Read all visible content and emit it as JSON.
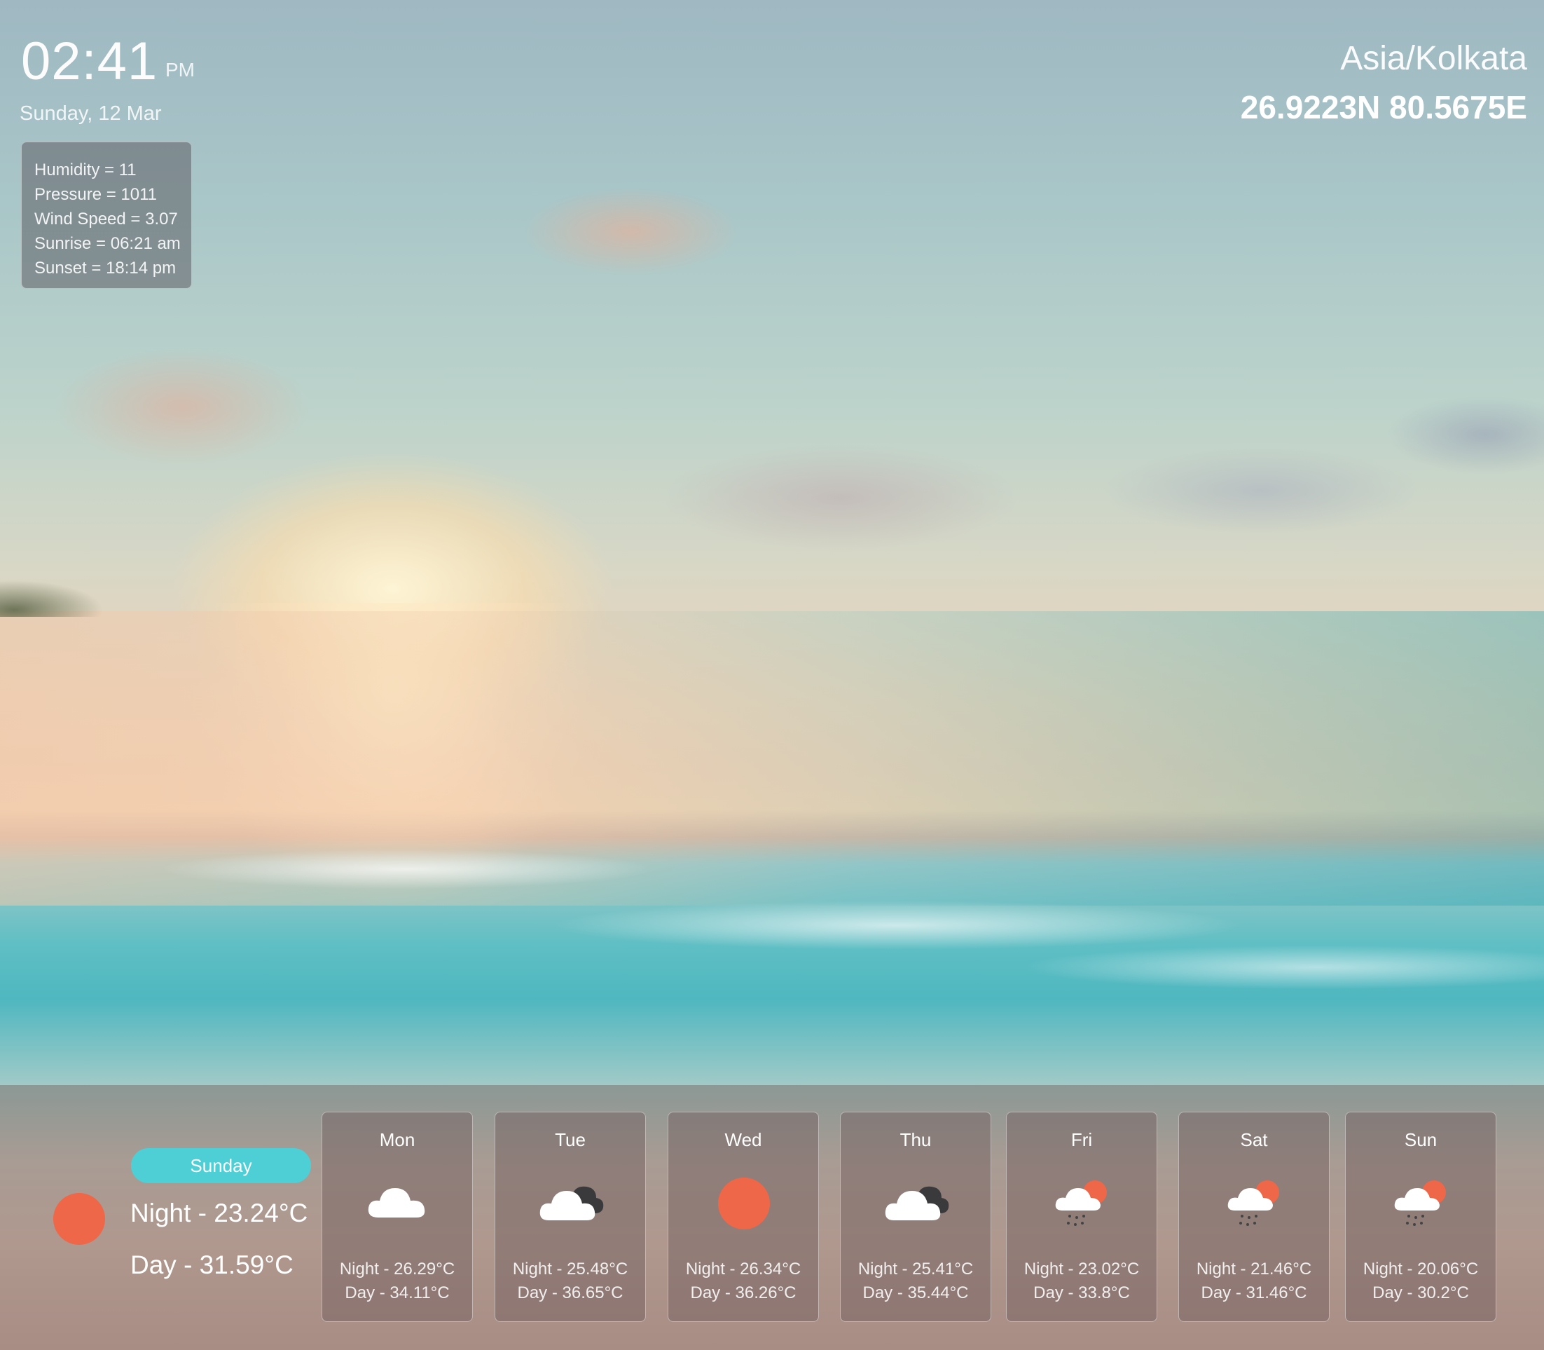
{
  "clock": {
    "time": "02:41",
    "ampm": "PM",
    "date": "Sunday, 12 Mar"
  },
  "details": [
    "Humidity = 11",
    "Pressure = 1011",
    "Wind Speed = 3.07",
    "Sunrise = 06:21 am",
    "Sunset = 18:14 pm"
  ],
  "location": {
    "timezone": "Asia/Kolkata",
    "coords": "26.9223N 80.5675E"
  },
  "today": {
    "badge": "Sunday",
    "icon": "sun-icon",
    "night": "Night - 23.24°C",
    "day": "Day - 31.59°C"
  },
  "colors": {
    "accent": "#4ecfd6",
    "sun": "#ee6749"
  },
  "forecast": [
    {
      "day": "Mon",
      "icon": "cloud-icon",
      "night": "Night - 26.29°C",
      "day_temp": "Day - 34.11°C"
    },
    {
      "day": "Tue",
      "icon": "broken-clouds-icon",
      "night": "Night - 25.48°C",
      "day_temp": "Day - 36.65°C"
    },
    {
      "day": "Wed",
      "icon": "sun-icon",
      "night": "Night - 26.34°C",
      "day_temp": "Day - 36.26°C"
    },
    {
      "day": "Thu",
      "icon": "broken-clouds-icon",
      "night": "Night - 25.41°C",
      "day_temp": "Day - 35.44°C"
    },
    {
      "day": "Fri",
      "icon": "rain-sun-icon",
      "night": "Night - 23.02°C",
      "day_temp": "Day - 33.8°C"
    },
    {
      "day": "Sat",
      "icon": "rain-sun-icon",
      "night": "Night - 21.46°C",
      "day_temp": "Day - 31.46°C"
    },
    {
      "day": "Sun",
      "icon": "rain-sun-icon",
      "night": "Night - 20.06°C",
      "day_temp": "Day - 30.2°C"
    }
  ]
}
